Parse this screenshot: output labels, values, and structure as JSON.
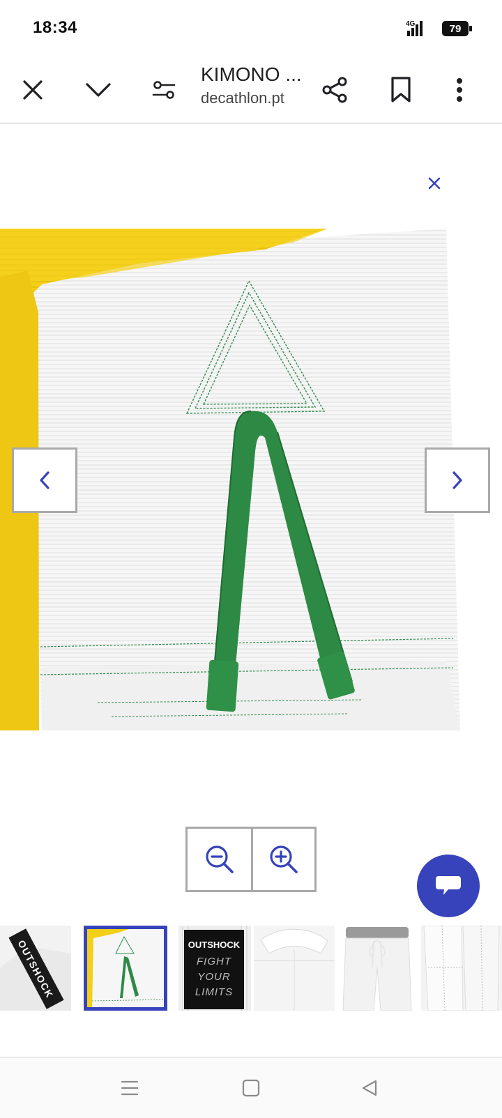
{
  "status_bar": {
    "time": "18:34",
    "network": "4G",
    "battery_level": "79",
    "icons": [
      "signal-icon",
      "battery-icon"
    ]
  },
  "app_bar": {
    "title": "KIMONO ...",
    "domain": "decathlon.pt",
    "icons": [
      "close-icon",
      "chevron-down-icon",
      "tune-icon",
      "share-icon",
      "bookmark-icon",
      "more-vert-icon"
    ]
  },
  "viewer": {
    "close_icon": "close-icon",
    "prev_icon": "chevron-left-icon",
    "next_icon": "chevron-right-icon",
    "zoom_out_icon": "zoom-out-icon",
    "zoom_in_icon": "zoom-in-icon",
    "main_image": {
      "subject": "white kimono hem with green belt loop and yellow belt",
      "colors": {
        "fabric": "#f4f4f4",
        "belt": "#f2cf1a",
        "stitch": "#2e8b4a",
        "loop": "#2c8a44"
      }
    },
    "thumbnails": [
      {
        "id": "thumb-1",
        "label": "OUTSHOCK",
        "active": false
      },
      {
        "id": "thumb-2",
        "label": "",
        "active": true
      },
      {
        "id": "thumb-3",
        "label_lines": [
          "OUTSHOCK",
          "FIGHT",
          "YOUR",
          "LIMITS"
        ],
        "active": false
      },
      {
        "id": "thumb-4",
        "label": "",
        "active": false
      },
      {
        "id": "thumb-5",
        "label": "",
        "active": false
      },
      {
        "id": "thumb-6",
        "label": "",
        "active": false
      }
    ]
  },
  "chat": {
    "icon": "chat-bubble-icon",
    "color": "#3643ba"
  },
  "system_nav": {
    "icons": [
      "menu-icon",
      "home-icon",
      "back-icon"
    ]
  },
  "colors": {
    "accent": "#3643ba",
    "border": "#a9a9a9"
  }
}
